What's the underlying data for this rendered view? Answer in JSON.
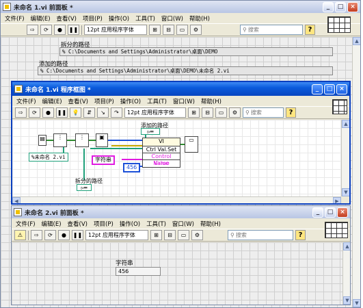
{
  "front_panel_1": {
    "title": "未命名 1.vi 前面板 *",
    "menu": [
      "文件(F)",
      "编辑(E)",
      "查看(V)",
      "项目(P)",
      "操作(O)",
      "工具(T)",
      "窗口(W)",
      "帮助(H)"
    ],
    "font_select": "12pt 应用程序字体",
    "search_placeholder": "搜索",
    "split_path_label": "拆分的路径",
    "split_path_value": "C:\\Documents and Settings\\Administrator\\桌面\\DEMO",
    "added_path_label": "添加的路径",
    "added_path_value": "C:\\Documents and Settings\\Administrator\\桌面\\DEMO\\未命名 2.vi"
  },
  "block_diagram": {
    "title": "未命名 1.vi 程序框图 *",
    "menu": [
      "文件(F)",
      "编辑(E)",
      "查看(V)",
      "项目(P)",
      "操作(O)",
      "工具(T)",
      "窗口(W)",
      "帮助(H)"
    ],
    "font_select": "12pt 应用程序字体",
    "search_placeholder": "搜索",
    "added_path_label": "添加的路径",
    "vi_path_const": "未命名 2.vi",
    "split_path_label": "拆分的路径",
    "vi_label": "VI",
    "ctrl_method": "Ctrl Val.Set",
    "control_name": "Control Name",
    "value_label": "Value",
    "string_const": "字符串",
    "number_const": "456"
  },
  "front_panel_2": {
    "title": "未命名 2.vi 前面板 *",
    "menu": [
      "文件(F)",
      "编辑(E)",
      "查看(V)",
      "项目(P)",
      "操作(O)",
      "工具(T)",
      "窗口(W)",
      "帮助(H)"
    ],
    "font_select": "12pt 应用程序字体",
    "search_placeholder": "搜索",
    "string_label": "字符串",
    "string_value": "456"
  },
  "colors": {
    "title_active": "#0a5bdc",
    "wire_pink": "#e01ae0",
    "wire_green": "#2e8b2e",
    "wire_blue": "#1b4fd8"
  }
}
